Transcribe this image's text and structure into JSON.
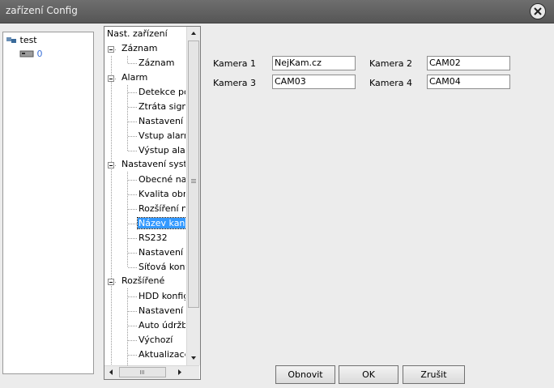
{
  "window": {
    "title": "zařízení Config"
  },
  "devices": {
    "group": "test",
    "device": "0"
  },
  "tree": {
    "items": [
      "Nast. zařízení",
      "Záznam",
      "Záznam",
      "Alarm",
      "Detekce po",
      "Ztráta signá",
      "Nastavení p",
      "Vstup alarr",
      "Výstup alar",
      "Nastavení syst",
      "Obecné na",
      "Kvalita obr",
      "Rozšíření n",
      "Název kana",
      "RS232",
      "Nastavení I",
      "Síťová konf",
      "Rozšířené",
      "HDD konfig",
      "Nastavení (",
      "Auto údržb",
      "Výchozí",
      "Aktualizace"
    ]
  },
  "cameras": [
    {
      "label": "Kamera 1",
      "value": "NejKam.cz"
    },
    {
      "label": "Kamera 2",
      "value": "CAM02"
    },
    {
      "label": "Kamera 3",
      "value": "CAM03"
    },
    {
      "label": "Kamera 4",
      "value": "CAM04"
    }
  ],
  "buttons": {
    "refresh": "Obnovit",
    "ok": "OK",
    "cancel": "Zrušit"
  }
}
